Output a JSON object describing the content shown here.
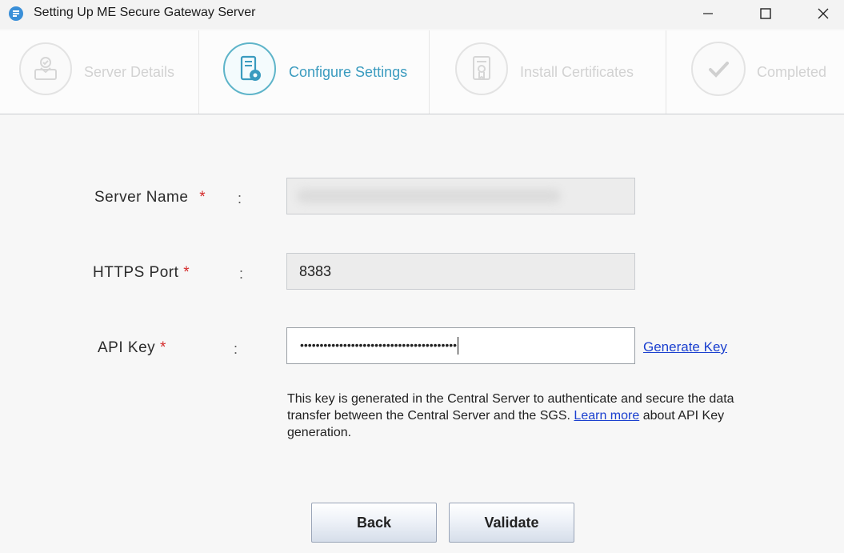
{
  "window": {
    "title": "Setting Up ME Secure Gateway Server",
    "app_icon": "gateway-app-icon",
    "controls": [
      "minimize-icon",
      "maximize-icon",
      "close-icon"
    ]
  },
  "steps": [
    {
      "label": "Server Details",
      "state": "inactive",
      "icon": "server-details-icon"
    },
    {
      "label": "Configure Settings",
      "state": "active",
      "icon": "configure-settings-icon"
    },
    {
      "label": "Install Certificates",
      "state": "inactive",
      "icon": "certificate-icon"
    },
    {
      "label": "Completed",
      "state": "inactive",
      "icon": "checkmark-icon"
    }
  ],
  "form": {
    "server_name": {
      "label": "Server Name",
      "required_mark": "*",
      "colon": ":",
      "value": ""
    },
    "https_port": {
      "label": "HTTPS Port",
      "required_mark": "*",
      "colon": ":",
      "value": "8383"
    },
    "api_key": {
      "label": "API Key",
      "required_mark": "*",
      "colon": ":",
      "value": "••••••••••••••••••••••••••••••••••••••••"
    },
    "generate_key_link": "Generate Key",
    "help_text_before": "This key is generated in the Central Server to authenticate and secure the data transfer between the Central Server and the SGS. ",
    "help_link": "Learn more",
    "help_text_after": " about API Key generation."
  },
  "buttons": {
    "back": "Back",
    "validate": "Validate"
  },
  "colors": {
    "accent": "#3a9bbf",
    "required": "#d42a2a",
    "link": "#1a3fcf"
  }
}
